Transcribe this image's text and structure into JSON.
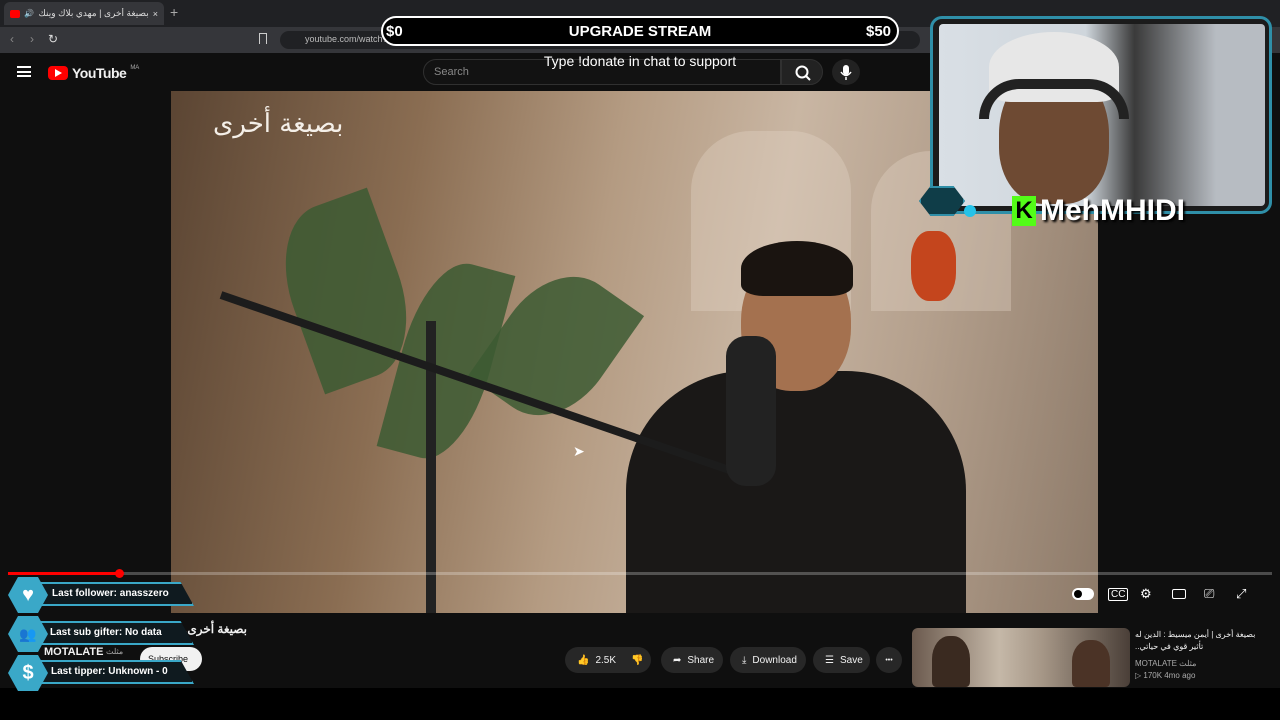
{
  "browser": {
    "tab_title": "بصيغة أخرى | مهدي بلاك وينك...",
    "tab_close": "×",
    "new_tab": "+",
    "url": "youtube.com/watch?v=8ybW-pgkYPA",
    "back_icon": "‹",
    "forward_icon": "›",
    "reload_icon": "↻"
  },
  "youtube": {
    "logo_text": "YouTube",
    "country_code": "MA",
    "search_placeholder": "Search"
  },
  "video": {
    "watermark": "بصيغة أخرى",
    "progress_fraction": 0.088,
    "title": "بصيغة أخرى.",
    "channel": "MOTALATE",
    "channel_sub": "مثلث",
    "subscribe_label": "Subscribe"
  },
  "actions": {
    "likes": "2.5K",
    "share": "Share",
    "download": "Download",
    "save": "Save",
    "more": "•••"
  },
  "suggested": {
    "title": "بصيغة أخرى | أيمن ميسيط : الدين له تأثير قوي في حياتي..",
    "channel": "MOTALATE مثلث",
    "meta": "▷ 170K  4mo ago"
  },
  "overlay": {
    "left_amount": "$0",
    "title": "UPGRADE STREAM",
    "right_amount": "$50",
    "subtitle": "Type !donate in chat to support",
    "streamer_name": "MehMHIDI",
    "kick_letter": "K"
  },
  "alerts": [
    {
      "icon": "♥",
      "text": "Last follower: anasszero"
    },
    {
      "icon": "👥",
      "text": "Last sub gifter: No data"
    },
    {
      "icon": "$",
      "text": "Last tipper: Unknown - 0"
    }
  ],
  "colors": {
    "accent_teal": "#3aa8c8",
    "kick_green": "#53fc18",
    "yt_red": "#ff0000"
  }
}
